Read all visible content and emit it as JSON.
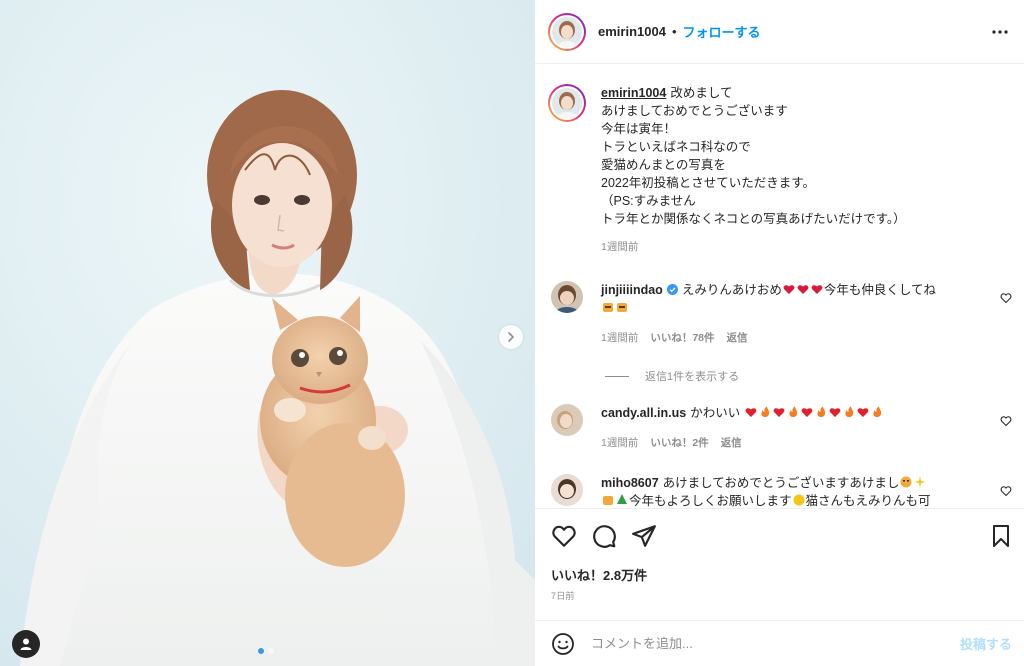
{
  "post": {
    "username": "emirin1004",
    "follow_label": "フォローする",
    "separator": "•",
    "caption": {
      "lines": [
        "改めまして",
        "あけましておめでとうございます",
        "今年は寅年！",
        "トラといえばネコ科なので",
        "愛猫めんまとの写真を",
        "2022年初投稿とさせていただきます。",
        "（PS:すみません",
        "トラ年とか関係なくネコとの写真あげたいだけです。）"
      ],
      "time": "1週間前"
    },
    "carousel": {
      "current": 1,
      "total": 2
    }
  },
  "comments": [
    {
      "username": "jinjiiiindao",
      "verified": true,
      "text_before": "えみりんあけおめ",
      "text_after": "今年も仲良くしてね",
      "time": "1週間前",
      "likes": "いいね！78件",
      "reply": "返信",
      "view_replies": "返信1件を表示する",
      "emoji": [
        "heart-sparkle",
        "heart-sparkle",
        "heart-sparkle",
        "tiger",
        "tiger"
      ]
    },
    {
      "username": "candy.all.in.us",
      "text": "かわいい",
      "time": "1週間前",
      "likes": "いいね！2件",
      "reply": "返信",
      "emoji": [
        "heart",
        "fire",
        "heart",
        "fire",
        "heart",
        "fire",
        "heart",
        "fire",
        "heart",
        "fire"
      ]
    },
    {
      "username": "miho8607",
      "text_line1": "あけましておめでとうございますあけまし",
      "text_line2": "今年もよろしくお願いします",
      "text_line3": "猫さんもえみりんも可"
    }
  ],
  "actions": {
    "likes": "いいね！2.8万件",
    "time_ago": "7日前"
  },
  "add_comment": {
    "placeholder": "コメントを追加...",
    "post_label": "投稿する"
  },
  "colors": {
    "link_blue": "#0095f6",
    "post_disabled": "#b2dffc",
    "muted": "#8e8e8e",
    "text": "#262626"
  }
}
